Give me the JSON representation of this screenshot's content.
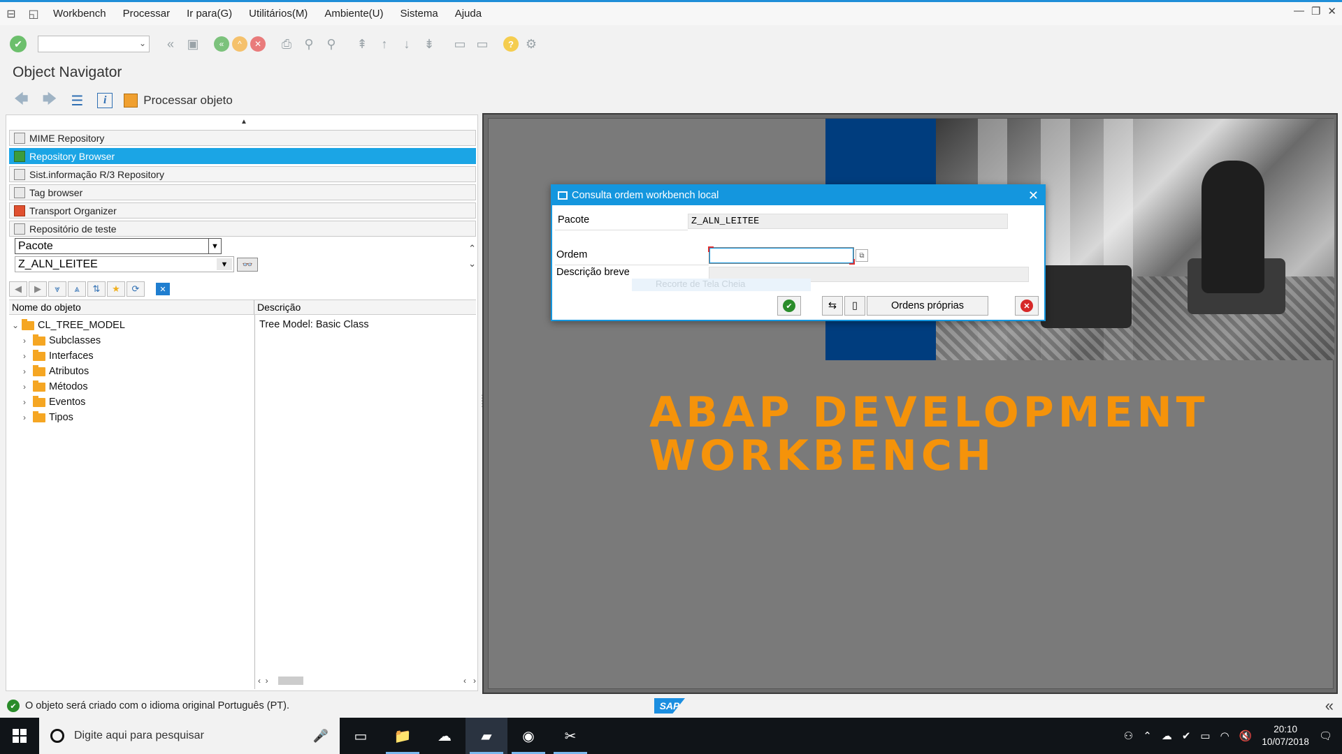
{
  "menubar": {
    "items": [
      "Workbench",
      "Processar",
      "Ir para(G)",
      "Utilitários(M)",
      "Ambiente(U)",
      "Sistema",
      "Ajuda"
    ]
  },
  "title": "Object Navigator",
  "apptoolbar": {
    "process_label": "Processar objeto"
  },
  "nav": {
    "items": [
      "MIME Repository",
      "Repository Browser",
      "Sist.informação R/3 Repository",
      "Tag browser",
      "Transport Organizer",
      "Repositório de teste"
    ],
    "active_index": 1
  },
  "selector": {
    "type_value": "Pacote",
    "object_value": "Z_ALN_LEITEE"
  },
  "tree": {
    "col_name": "Nome do objeto",
    "col_desc": "Descrição",
    "root": {
      "label": "CL_TREE_MODEL",
      "description": "Tree Model: Basic Class"
    },
    "children": [
      "Subclasses",
      "Interfaces",
      "Atributos",
      "Métodos",
      "Eventos",
      "Tipos"
    ]
  },
  "banner": {
    "line1": "ABAP DEVELOPMENT",
    "line2": "WORKBENCH"
  },
  "dialog": {
    "title": "Consulta ordem workbench local",
    "package_label": "Pacote",
    "package_value": "Z_ALN_LEITEE",
    "order_label": "Ordem",
    "order_value": "",
    "desc_label": "Descrição breve",
    "desc_value": "",
    "ghost_text": "Recorte de Tela Cheia",
    "own_orders_label": "Ordens próprias"
  },
  "status": {
    "message": "O objeto será criado com o idioma original Português (PT)."
  },
  "taskbar": {
    "search_placeholder": "Digite aqui para pesquisar",
    "time": "20:10",
    "date": "10/07/2018"
  },
  "colors": {
    "accent": "#1496de",
    "banner": "#f5930a",
    "selected": "#1ba5e5"
  }
}
